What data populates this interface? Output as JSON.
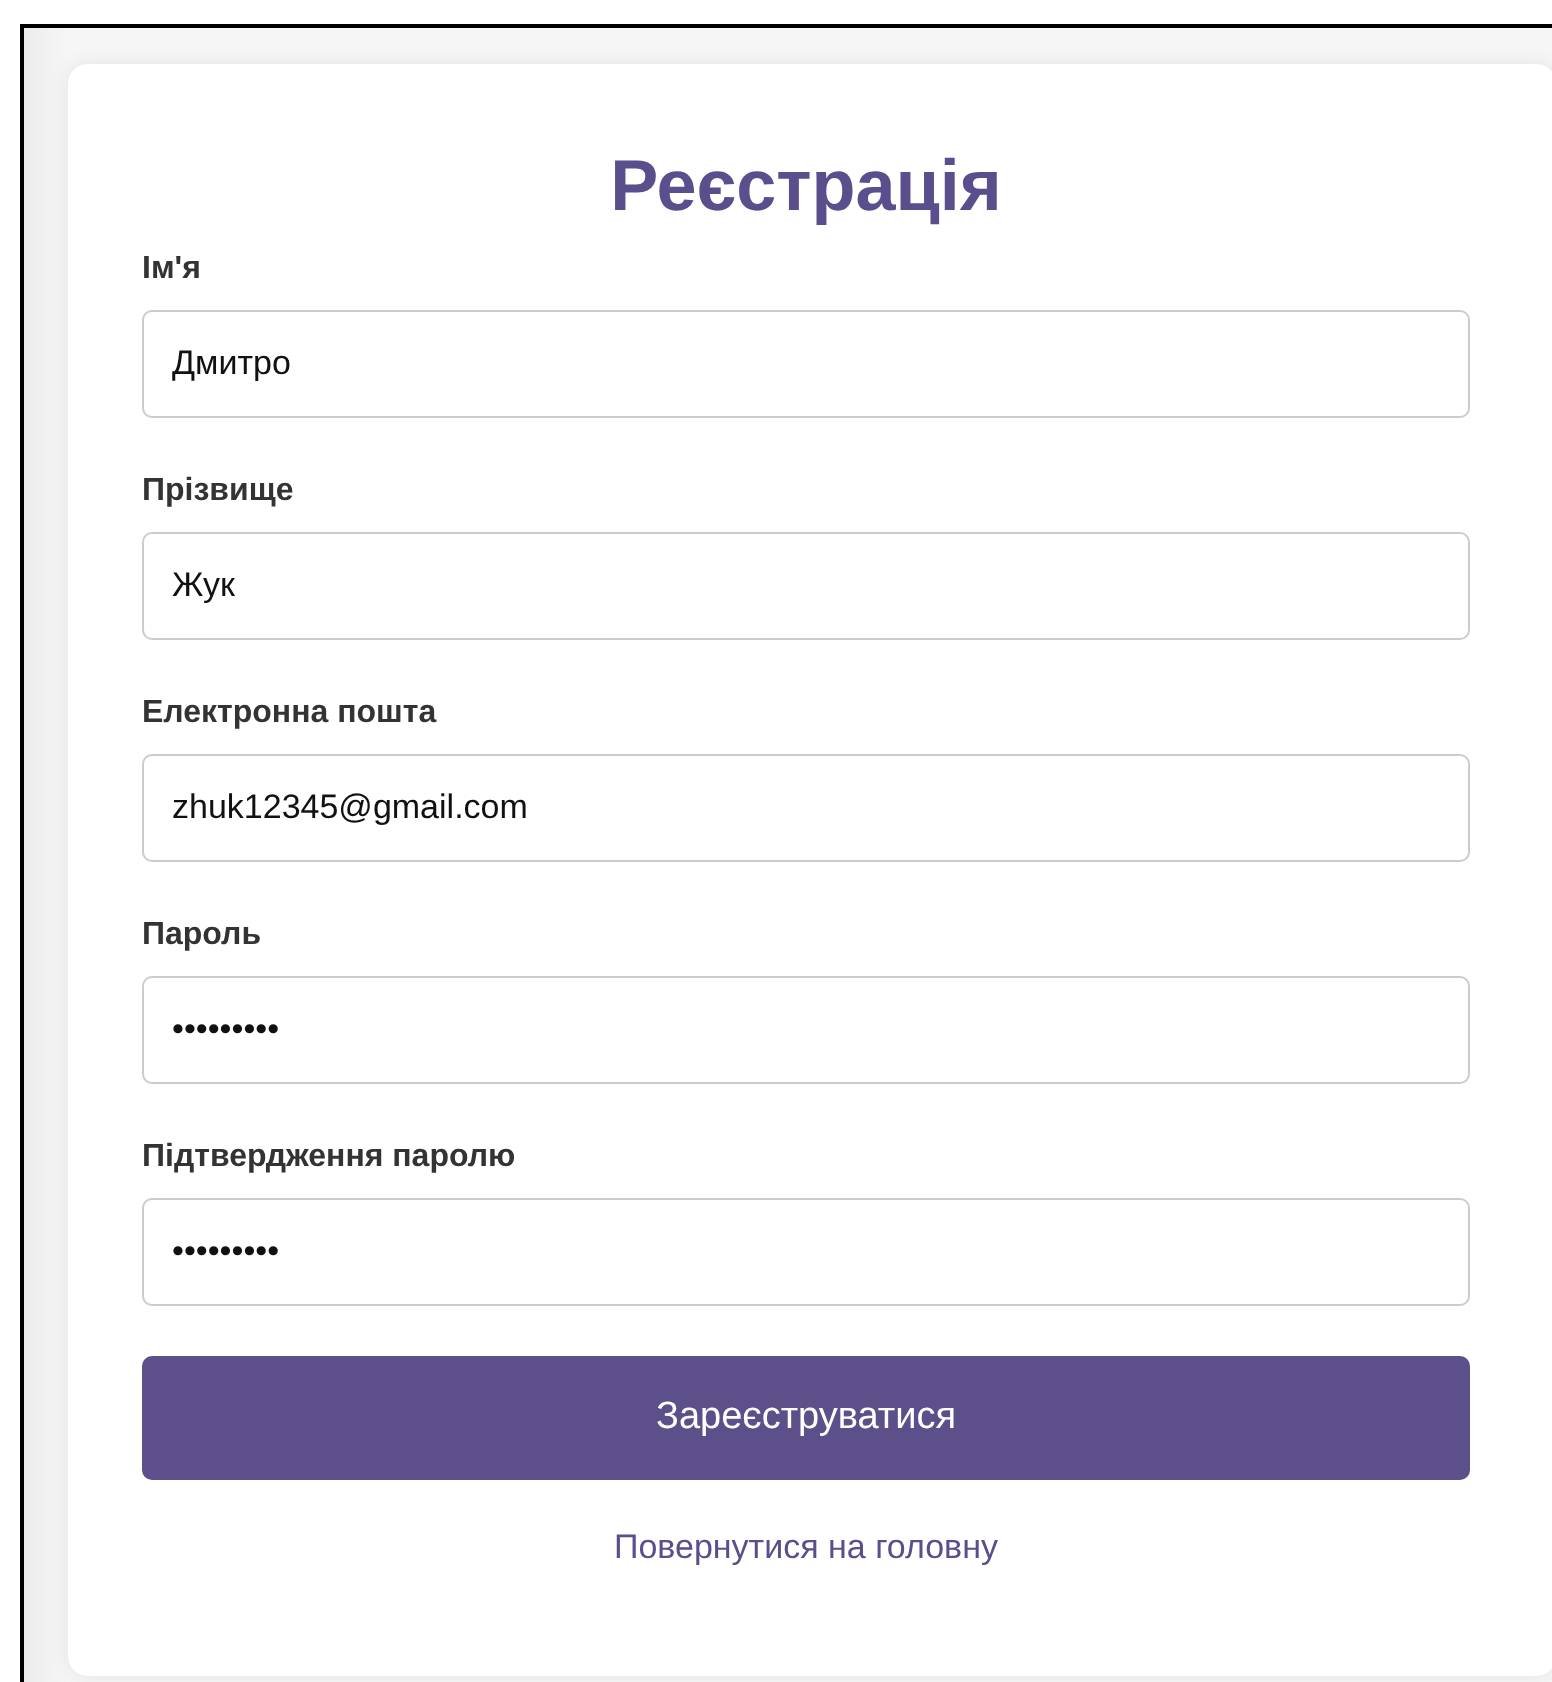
{
  "title": "Реєстрація",
  "fields": [
    {
      "label": "Ім'я",
      "value": "Дмитро"
    },
    {
      "label": "Прізвище",
      "value": "Жук"
    },
    {
      "label": "Електронна пошта",
      "value": "zhuk12345@gmail.com"
    },
    {
      "label": "Пароль",
      "value": "•••••••••"
    },
    {
      "label": "Підтвердження паролю",
      "value": "•••••••••"
    }
  ],
  "submit_button": "Зареєструватися",
  "back_link": "Повернутися на головну"
}
